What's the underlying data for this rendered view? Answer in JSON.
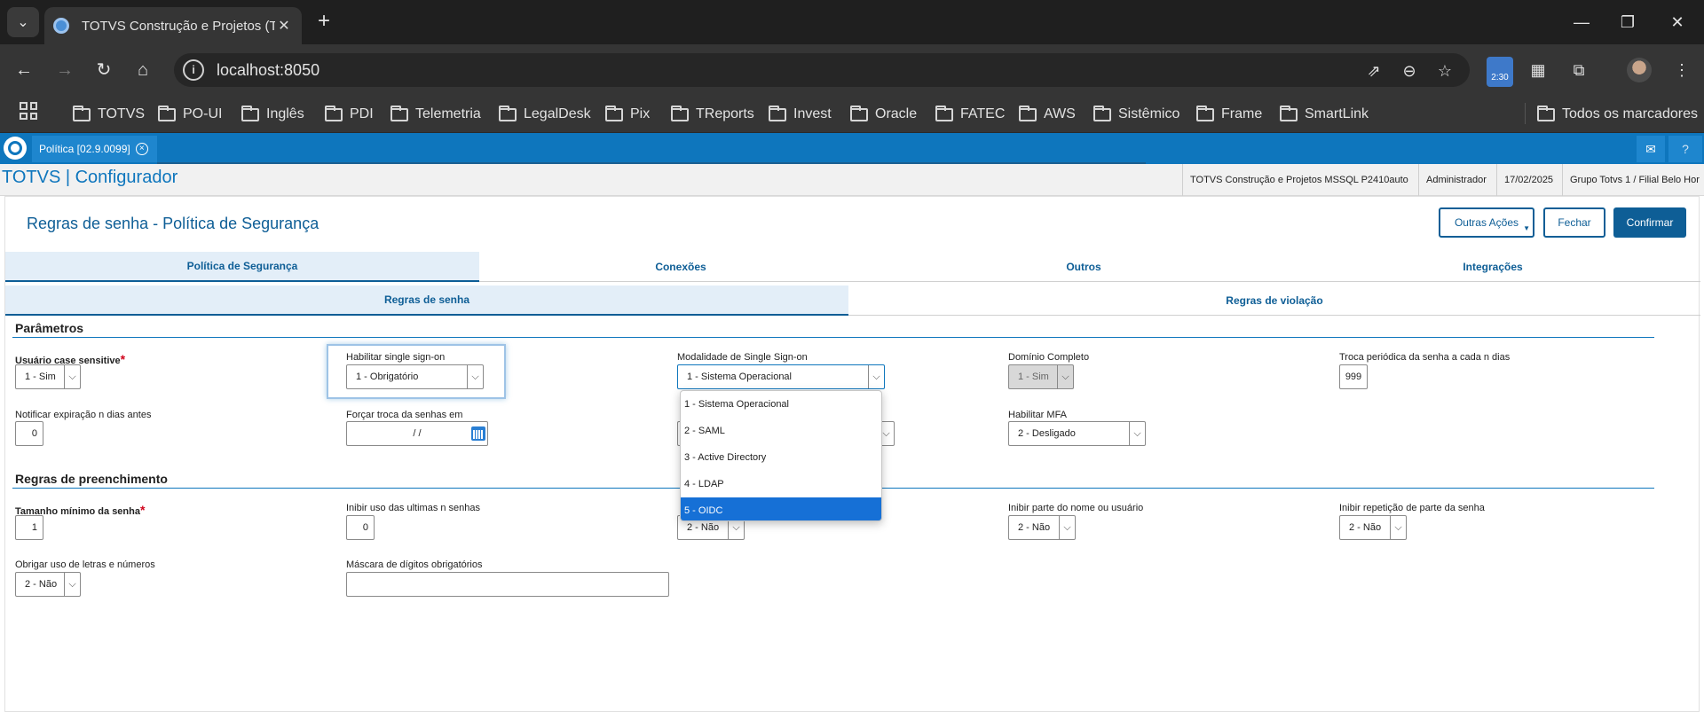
{
  "browser": {
    "tab_title": "TOTVS Construção e Projetos (T",
    "url": "localhost:8050",
    "extension_timer": "2:30",
    "bookmarks": [
      "TOTVS",
      "PO-UI",
      "Inglês",
      "PDI",
      "Telemetria",
      "LegalDesk",
      "Pix",
      "TReports",
      "Invest",
      "Oracle",
      "FATEC",
      "AWS",
      "Sistêmico",
      "Frame",
      "SmartLink"
    ],
    "all_bookmarks": "Todos os marcadores"
  },
  "app": {
    "program_tab": "Política [02.9.0099]",
    "name": "TOTVS | Configurador",
    "header": {
      "environment": "TOTVS Construção e Projetos MSSQL P2410auto",
      "user": "Administrador",
      "date": "17/02/2025",
      "branch": "Grupo Totvs 1 / Filial Belo Hor"
    }
  },
  "dialog": {
    "title": "Regras de senha - Política de Segurança",
    "buttons": {
      "other_actions": "Outras Ações",
      "close": "Fechar",
      "confirm": "Confirmar"
    },
    "main_tabs": [
      "Política de Segurança",
      "Conexões",
      "Outros",
      "Integrações"
    ],
    "sub_tabs": [
      "Regras de senha",
      "Regras de violação"
    ],
    "sections": {
      "parameters": "Parâmetros",
      "fill_rules": "Regras de preenchimento"
    },
    "fields": {
      "case_sensitive": {
        "label": "Usuário case sensitive",
        "value": "1 - Sim"
      },
      "sso_enable": {
        "label": "Habilitar single sign-on",
        "value": "1 - Obrigatório"
      },
      "sso_mode": {
        "label": "Modalidade de Single Sign-on",
        "value": "1 - Sistema Operacional"
      },
      "full_domain": {
        "label": "Domínio Completo",
        "value": "1 - Sim"
      },
      "periodic_change": {
        "label": "Troca periódica da senha a cada n dias",
        "value": "999"
      },
      "notify_expiration": {
        "label": "Notificar expiração n dias antes",
        "value": "0"
      },
      "force_change": {
        "label": "Forçar troca da senhas em",
        "value": "/ /"
      },
      "mfa": {
        "label": "Habilitar MFA",
        "value": "2 - Desligado"
      },
      "min_length": {
        "label": "Tamanho mínimo da senha",
        "value": "1"
      },
      "inhibit_last": {
        "label": "Inibir uso das ultimas n senhas",
        "value": "0"
      },
      "hidden_combo": {
        "value": "2 - Não"
      },
      "inhibit_name": {
        "label": "Inibir parte do nome ou usuário",
        "value": "2 - Não"
      },
      "inhibit_repeat": {
        "label": "Inibir repetição de parte da senha",
        "value": "2 - Não"
      },
      "letters_numbers": {
        "label": "Obrigar uso de letras e números",
        "value": "2 - Não"
      },
      "digit_mask": {
        "label": "Máscara de dígitos obrigatórios",
        "value": ""
      }
    },
    "sso_options": [
      "1 - Sistema Operacional",
      "2 - SAML",
      "3 - Active Directory",
      "4 - LDAP",
      "5 - OIDC"
    ],
    "sso_highlighted_option": "5 - OIDC"
  }
}
